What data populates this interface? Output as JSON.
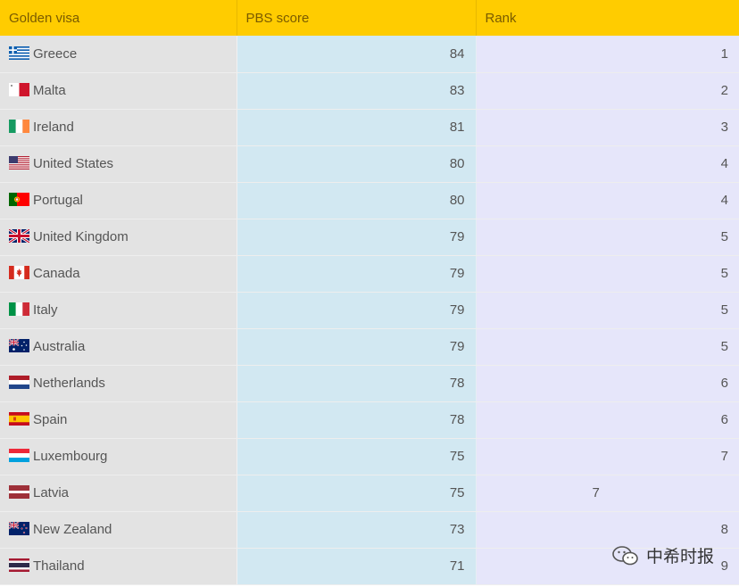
{
  "table": {
    "headers": [
      "Golden visa",
      "PBS score",
      "Rank"
    ],
    "rows": [
      {
        "country": "Greece",
        "flag": "greece-flag-icon",
        "score": "84",
        "rank": "1"
      },
      {
        "country": "Malta",
        "flag": "malta-flag-icon",
        "score": "83",
        "rank": "2"
      },
      {
        "country": "Ireland",
        "flag": "ireland-flag-icon",
        "score": "81",
        "rank": "3"
      },
      {
        "country": "United States",
        "flag": "usa-flag-icon",
        "score": "80",
        "rank": "4"
      },
      {
        "country": "Portugal",
        "flag": "portugal-flag-icon",
        "score": "80",
        "rank": "4"
      },
      {
        "country": "United Kingdom",
        "flag": "uk-flag-icon",
        "score": "79",
        "rank": "5"
      },
      {
        "country": "Canada",
        "flag": "canada-flag-icon",
        "score": "79",
        "rank": "5"
      },
      {
        "country": "Italy",
        "flag": "italy-flag-icon",
        "score": "79",
        "rank": "5"
      },
      {
        "country": "Australia",
        "flag": "australia-flag-icon",
        "score": "79",
        "rank": "5"
      },
      {
        "country": "Netherlands",
        "flag": "netherlands-flag-icon",
        "score": "78",
        "rank": "6"
      },
      {
        "country": "Spain",
        "flag": "spain-flag-icon",
        "score": "78",
        "rank": "6"
      },
      {
        "country": "Luxembourg",
        "flag": "luxembourg-flag-icon",
        "score": "75",
        "rank": "7"
      },
      {
        "country": "Latvia",
        "flag": "latvia-flag-icon",
        "score": "75",
        "rank": "7"
      },
      {
        "country": "New Zealand",
        "flag": "newzealand-flag-icon",
        "score": "73",
        "rank": "8"
      },
      {
        "country": "Thailand",
        "flag": "thailand-flag-icon",
        "score": "71",
        "rank": "9"
      }
    ]
  },
  "watermark": {
    "text": "中希时报",
    "icon": "wechat-icon"
  },
  "colors": {
    "header": "#ffcc00",
    "country_col": "#e3e3e3",
    "score_col": "#d2e8f2",
    "rank_col": "#e6e6fa"
  }
}
